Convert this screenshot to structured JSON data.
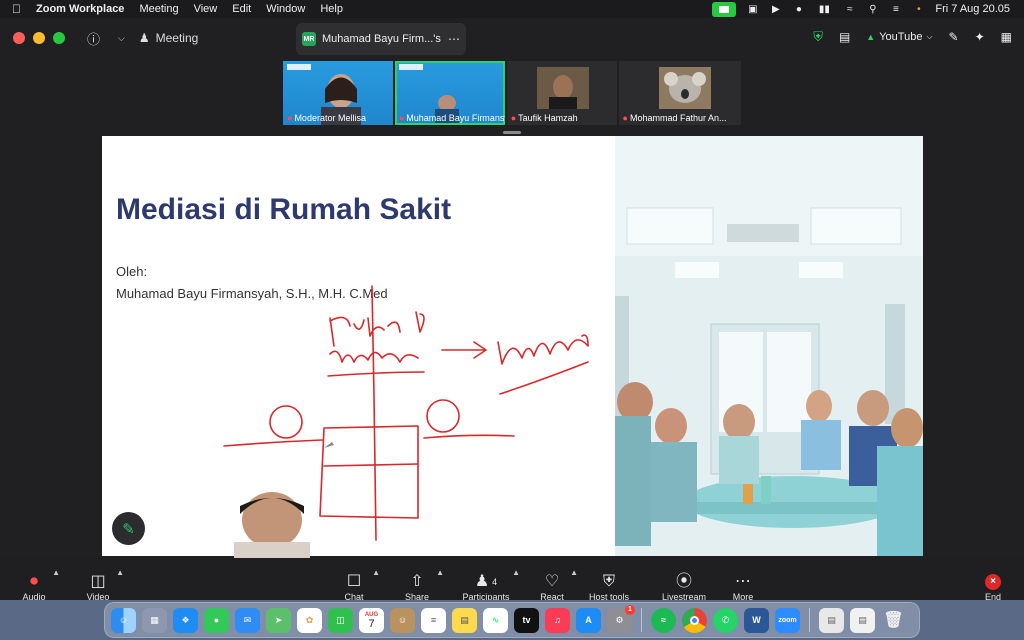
{
  "menubar": {
    "app_name": "Zoom Workplace",
    "items": [
      "Meeting",
      "View",
      "Edit",
      "Window",
      "Help"
    ],
    "datetime": "Fri 7 Aug  20.05"
  },
  "titlebar": {
    "meeting_label": "Meeting",
    "share_tab_badge": "MR",
    "share_tab_label": "Muhamad Bayu Firm...'s scre",
    "youtube_label": "YouTube"
  },
  "participants": [
    {
      "name": "Moderator Mellisa"
    },
    {
      "name": "Muhamad Bayu Firmansy..."
    },
    {
      "name": "Taufik Hamzah"
    },
    {
      "name": "Mohammad Fathur An..."
    }
  ],
  "slide": {
    "title": "Mediasi di Rumah Sakit",
    "oleh": "Oleh:",
    "author": "Muhamad Bayu Firmansyah, S.H., M.H. C.Med"
  },
  "toolbar": {
    "audio": "Audio",
    "video": "Video",
    "chat": "Chat",
    "share": "Share",
    "participants": "Participants",
    "participants_count": "4",
    "react": "React",
    "host_tools": "Host tools",
    "livestream": "Livestream",
    "more": "More",
    "end": "End"
  },
  "dock": {
    "calendar_month": "AUG",
    "calendar_day": "7",
    "settings_badge": "1",
    "appletv_label": "tv",
    "zoom_label": "zoom"
  },
  "colors": {
    "accent_green": "#2fd36b",
    "slide_title": "#2e3a6e",
    "annotation_red": "#d8282c",
    "end_red": "#e02828"
  }
}
